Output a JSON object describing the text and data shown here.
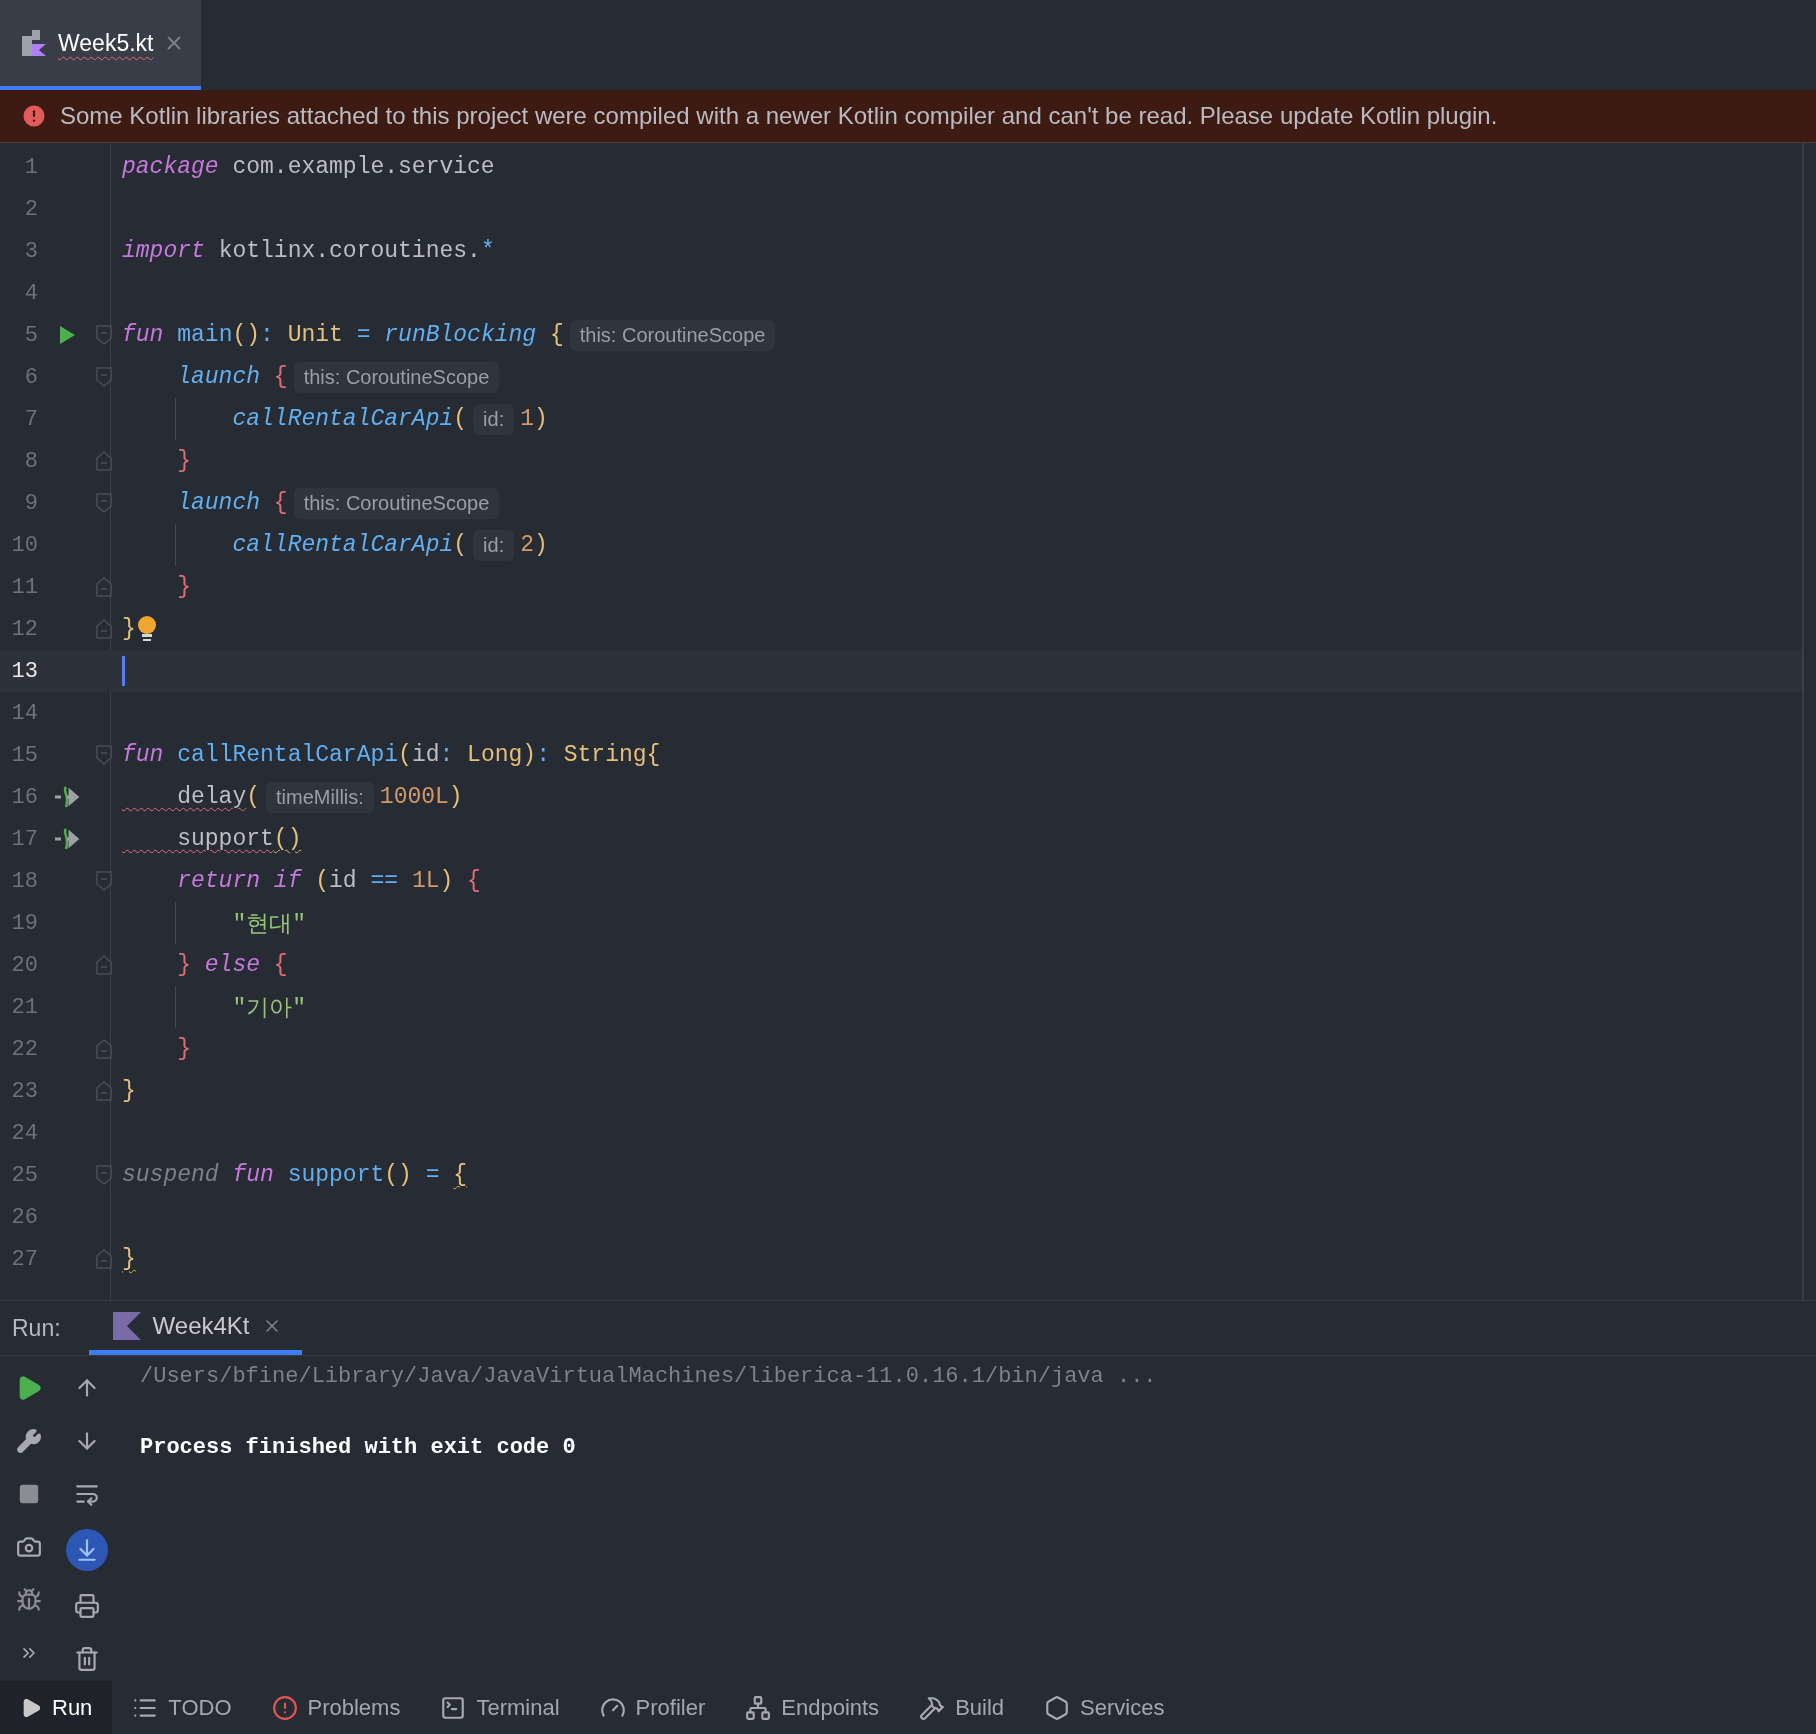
{
  "editor_tabs": [
    {
      "label": "Week5.kt",
      "selected": true,
      "has_error": true
    }
  ],
  "banner": {
    "kind": "error",
    "text": "Some Kotlin libraries attached to this project were compiled with a newer Kotlin compiler and can't be read. Please update Kotlin plugin."
  },
  "code_lines": [
    {
      "number": "1",
      "tokens": [
        {
          "kind": "kw",
          "text": "package"
        },
        {
          "kind": "plain",
          "text": " com.example.service"
        }
      ]
    },
    {
      "number": "2"
    },
    {
      "number": "3",
      "tokens": [
        {
          "kind": "kw",
          "text": "import"
        },
        {
          "kind": "plain",
          "text": " kotlinx.coroutines."
        },
        {
          "kind": "op",
          "text": "*"
        }
      ]
    },
    {
      "number": "4"
    },
    {
      "number": "5",
      "run_marker": true,
      "fold_start": true,
      "tokens": [
        {
          "kind": "kw",
          "text": "fun"
        },
        {
          "kind": "decl",
          "text": " main"
        },
        {
          "kind": "paren",
          "text": "()"
        },
        {
          "kind": "op",
          "text": ": "
        },
        {
          "kind": "type",
          "text": "Unit"
        },
        {
          "kind": "op",
          "text": " = "
        },
        {
          "kind": "call",
          "text": "runBlocking"
        },
        {
          "kind": "brace1",
          "text": " {"
        },
        {
          "kind": "hint",
          "text": "this: CoroutineScope"
        }
      ]
    },
    {
      "number": "6",
      "fold_start": true,
      "tokens": [
        {
          "kind": "call",
          "text": "    launch"
        },
        {
          "kind": "brace2",
          "text": " {"
        },
        {
          "kind": "hint",
          "text": "this: CoroutineScope"
        }
      ]
    },
    {
      "number": "7",
      "guide": true,
      "tokens": [
        {
          "kind": "call",
          "text": "        callRentalCarApi"
        },
        {
          "kind": "paren",
          "text": "("
        },
        {
          "kind": "hint",
          "text": "id:"
        },
        {
          "kind": "num",
          "text": "1"
        },
        {
          "kind": "paren",
          "text": ")"
        }
      ]
    },
    {
      "number": "8",
      "fold_end": true,
      "tokens": [
        {
          "kind": "brace2",
          "text": "    }"
        }
      ]
    },
    {
      "number": "9",
      "fold_start": true,
      "tokens": [
        {
          "kind": "call",
          "text": "    launch"
        },
        {
          "kind": "brace2",
          "text": " {"
        },
        {
          "kind": "hint",
          "text": "this: CoroutineScope"
        }
      ]
    },
    {
      "number": "10",
      "guide": true,
      "tokens": [
        {
          "kind": "call",
          "text": "        callRentalCarApi"
        },
        {
          "kind": "paren",
          "text": "("
        },
        {
          "kind": "hint",
          "text": "id:"
        },
        {
          "kind": "num",
          "text": "2"
        },
        {
          "kind": "paren",
          "text": ")"
        }
      ]
    },
    {
      "number": "11",
      "fold_end": true,
      "tokens": [
        {
          "kind": "brace2",
          "text": "    }"
        }
      ]
    },
    {
      "number": "12",
      "fold_end": true,
      "bulb": true,
      "tokens": [
        {
          "kind": "brace1",
          "text": "}"
        }
      ]
    },
    {
      "number": "13",
      "current": true
    },
    {
      "number": "14"
    },
    {
      "number": "15",
      "fold_start": true,
      "tokens": [
        {
          "kind": "kw",
          "text": "fun"
        },
        {
          "kind": "decl",
          "text": " callRentalCarApi"
        },
        {
          "kind": "paren",
          "text": "("
        },
        {
          "kind": "plain",
          "text": "id"
        },
        {
          "kind": "op",
          "text": ": "
        },
        {
          "kind": "type",
          "text": "Long"
        },
        {
          "kind": "paren",
          "text": ")"
        },
        {
          "kind": "op",
          "text": ": "
        },
        {
          "kind": "type",
          "text": "String"
        },
        {
          "kind": "brace1",
          "text": "{"
        }
      ]
    },
    {
      "number": "16",
      "suspend_marker": true,
      "tokens": [
        {
          "kind": "plain",
          "text": "    delay",
          "error_underline": true
        },
        {
          "kind": "paren",
          "text": "("
        },
        {
          "kind": "hint",
          "text": "timeMillis:"
        },
        {
          "kind": "num",
          "text": "1000L"
        },
        {
          "kind": "paren",
          "text": ")"
        }
      ]
    },
    {
      "number": "17",
      "suspend_marker": true,
      "tokens": [
        {
          "kind": "plain",
          "text": "    support",
          "error_underline": true
        },
        {
          "kind": "paren",
          "text": "()",
          "warning_underline": true
        }
      ]
    },
    {
      "number": "18",
      "fold_start": true,
      "tokens": [
        {
          "kind": "kw",
          "text": "    return if"
        },
        {
          "kind": "paren",
          "text": " ("
        },
        {
          "kind": "plain",
          "text": "id"
        },
        {
          "kind": "op",
          "text": " == "
        },
        {
          "kind": "num",
          "text": "1L"
        },
        {
          "kind": "paren",
          "text": ")"
        },
        {
          "kind": "brace2",
          "text": " {"
        }
      ]
    },
    {
      "number": "19",
      "guide": true,
      "tokens": [
        {
          "kind": "str",
          "text": "        \"현대\""
        }
      ]
    },
    {
      "number": "20",
      "fold_end": true,
      "tokens": [
        {
          "kind": "brace2",
          "text": "    }"
        },
        {
          "kind": "kw",
          "text": " else"
        },
        {
          "kind": "brace2",
          "text": " {"
        }
      ]
    },
    {
      "number": "21",
      "guide": true,
      "tokens": [
        {
          "kind": "str",
          "text": "        \"기아\""
        }
      ]
    },
    {
      "number": "22",
      "fold_end": true,
      "tokens": [
        {
          "kind": "brace2",
          "text": "    }"
        }
      ]
    },
    {
      "number": "23",
      "fold_end": true,
      "tokens": [
        {
          "kind": "brace1",
          "text": "}"
        }
      ]
    },
    {
      "number": "24"
    },
    {
      "number": "25",
      "fold_start": true,
      "tokens": [
        {
          "kind": "dim",
          "text": "suspend"
        },
        {
          "kind": "kw",
          "text": " fun"
        },
        {
          "kind": "decl",
          "text": " support"
        },
        {
          "kind": "paren",
          "text": "()"
        },
        {
          "kind": "op",
          "text": " = "
        },
        {
          "kind": "brace1",
          "text": "{",
          "warning_underline": true
        }
      ]
    },
    {
      "number": "26"
    },
    {
      "number": "27",
      "fold_end": true,
      "tokens": [
        {
          "kind": "brace1",
          "text": "}",
          "warning_underline": true
        }
      ]
    }
  ],
  "run_panel": {
    "label": "Run:",
    "tabs": [
      {
        "label": "Week4Kt",
        "selected": true
      }
    ],
    "scroll_to_end": true,
    "console": [
      {
        "kind": "command",
        "text": "/Users/bfine/Library/Java/JavaVirtualMachines/liberica-11.0.16.1/bin/java ..."
      },
      {
        "kind": "output",
        "text": "Process finished with exit code 0"
      }
    ]
  },
  "tool_windows": [
    {
      "label": "Run",
      "selected": true
    },
    {
      "label": "TODO",
      "selected": false
    },
    {
      "label": "Problems",
      "selected": false
    },
    {
      "label": "Terminal",
      "selected": false
    },
    {
      "label": "Profiler",
      "selected": false
    },
    {
      "label": "Endpoints",
      "selected": false
    },
    {
      "label": "Build",
      "selected": false
    },
    {
      "label": "Services",
      "selected": false
    }
  ]
}
